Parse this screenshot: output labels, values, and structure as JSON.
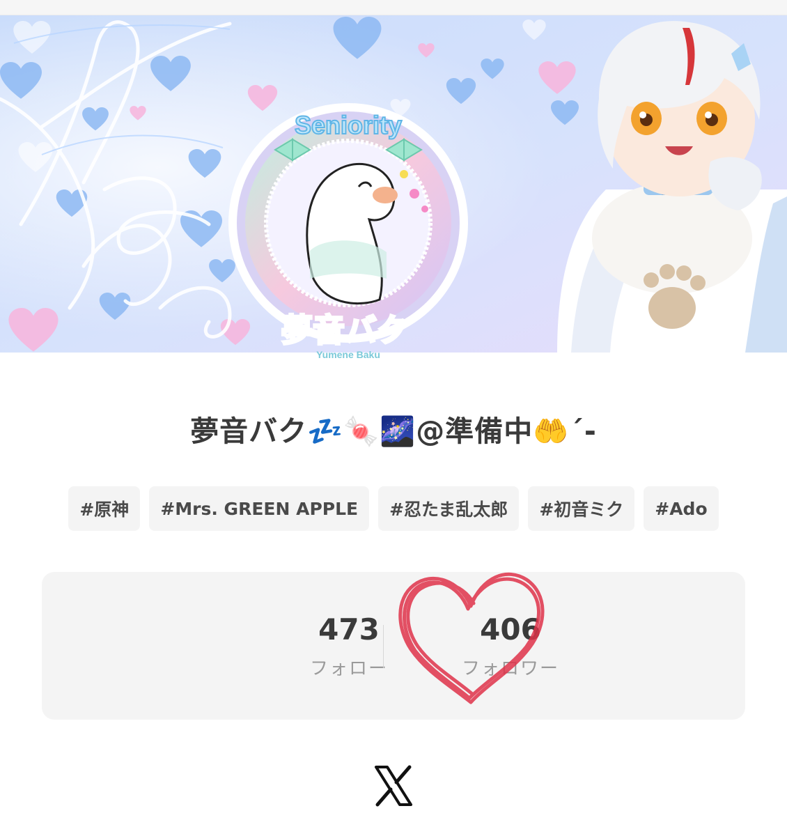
{
  "profile": {
    "display_name": "夢音バク💤🍬🌌@準備中🤲´-",
    "tags": [
      "#原神",
      "#Mrs. GREEN APPLE",
      "#忍たま乱太郎",
      "#初音ミク",
      "#Ado"
    ]
  },
  "avatar": {
    "badge_text": "Seniority",
    "logo_text": "夢音バク",
    "sub_text": "Yumene Baku"
  },
  "stats": {
    "following": {
      "count": "473",
      "label": "フォロー"
    },
    "followers": {
      "count": "406",
      "label": "フォロワー"
    }
  },
  "footer": {
    "icon": "x-logo-icon"
  },
  "colors": {
    "banner_bg": "#cfe0fb",
    "banner_bg_2": "#e3d6fb",
    "heart_blue": "#8db9f3",
    "heart_pink": "#f6b7de",
    "stats_card": "#f4f4f4",
    "doodle_heart": "#e0334a",
    "text_main": "#3a3a3a",
    "text_muted": "#9a9a9a"
  }
}
